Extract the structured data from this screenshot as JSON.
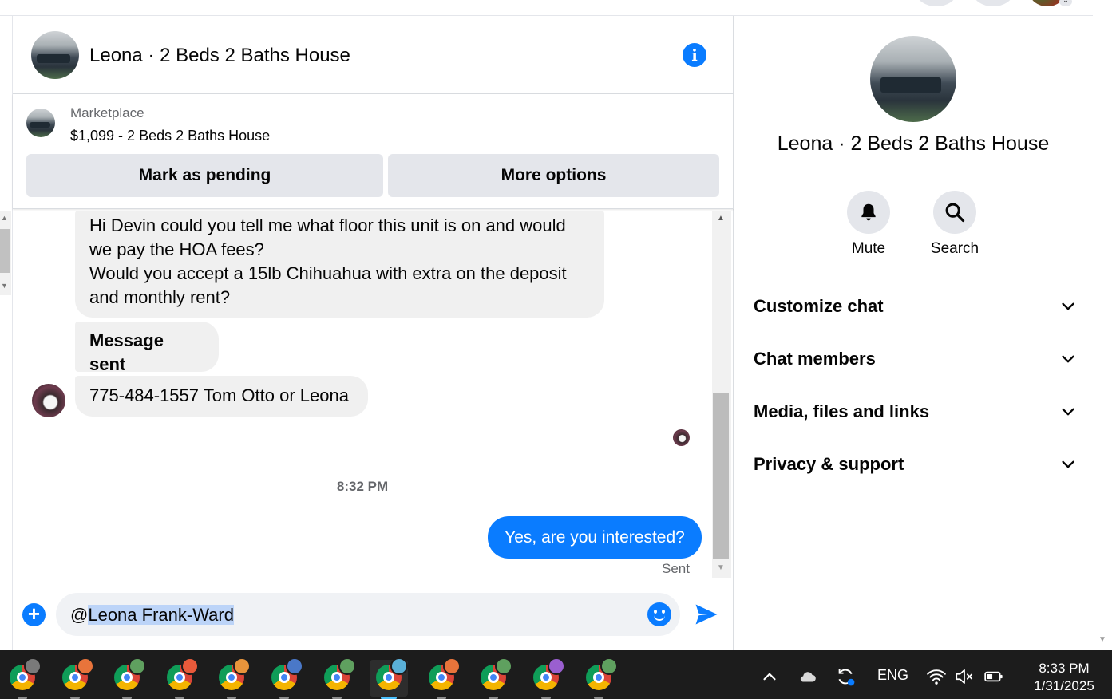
{
  "header": {
    "title": "Leona · 2 Beds 2 Baths House",
    "info_icon": "info-icon"
  },
  "listing": {
    "source": "Marketplace",
    "price_title": "$1,099 - 2 Beds 2 Baths House",
    "mark_pending_label": "Mark as pending",
    "more_options_label": "More options"
  },
  "messages": [
    {
      "direction": "incoming",
      "lines": [
        "Hi Devin could you tell me what floor this unit is on and would",
        "we pay the HOA fees?",
        "Would you accept a 15lb Chihuahua with extra on the deposit",
        "and monthly rent?"
      ]
    },
    {
      "direction": "incoming",
      "text": "Message sent"
    },
    {
      "direction": "incoming",
      "text": "775-484-1557 Tom Otto or Leona"
    },
    {
      "direction": "outgoing",
      "text": "Yes, are you interested?"
    }
  ],
  "timestamp": "8:32 PM",
  "sent_status": "Sent",
  "composer": {
    "at_symbol": "@",
    "mention": "Leona Frank-Ward"
  },
  "info_panel": {
    "title": "Leona · 2 Beds 2 Baths House",
    "mute_label": "Mute",
    "search_label": "Search",
    "sections": [
      "Customize chat",
      "Chat members",
      "Media, files and links",
      "Privacy & support"
    ]
  },
  "taskbar": {
    "language": "ENG",
    "time": "8:33 PM",
    "date": "1/31/2025",
    "app_count": 12,
    "profile_badge_colors": [
      "#7a7a7a",
      "#e8743b",
      "#5fa05f",
      "#e85a3b",
      "#e8943b",
      "#4a78c8",
      "#5fa05f",
      "#5ab0d8",
      "#e8743b",
      "#5fa05f",
      "#9a5fd0",
      "#5fa05f"
    ]
  },
  "colors": {
    "accent_blue": "#0a7cff",
    "bubble_gray": "#f0f0f0",
    "button_gray": "#e4e6eb",
    "taskbar": "#1c1c1c"
  }
}
